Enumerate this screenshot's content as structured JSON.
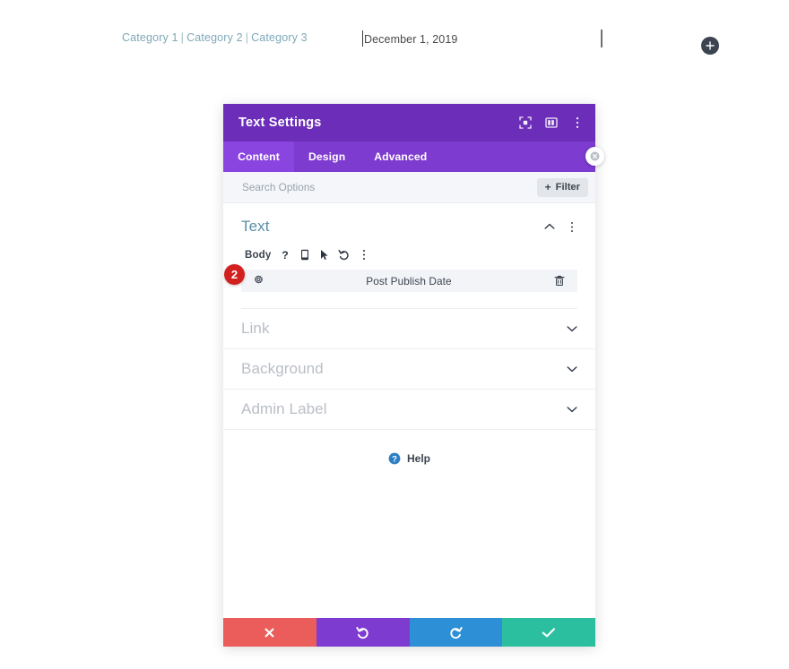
{
  "page": {
    "categories": [
      {
        "label": "Category 1"
      },
      {
        "label": "Category 2"
      },
      {
        "label": "Category 3"
      }
    ],
    "separator": "|",
    "date_text": "December 1, 2019",
    "add_button_icon": "plus-icon",
    "colors": {
      "link": "#7fa8b8",
      "header_purple": "#6c2eb9",
      "tab_purple": "#7e3bd0",
      "tab_active_purple": "#8a45e0",
      "badge_red": "#d2201f",
      "cancel_red": "#eb5d5b",
      "undo_purple": "#7e3bd0",
      "redo_blue": "#2d8fd5",
      "save_green": "#2bbfa0",
      "section_title_blue": "#5b8fa8",
      "muted_gray": "#b9bec5"
    }
  },
  "modal": {
    "title": "Text Settings",
    "header_icons": [
      {
        "name": "focus-target-icon"
      },
      {
        "name": "layout-columns-icon"
      },
      {
        "name": "kebab-menu-icon"
      }
    ],
    "close_icon": "close-icon",
    "tabs": [
      {
        "label": "Content",
        "active": true
      },
      {
        "label": "Design",
        "active": false
      },
      {
        "label": "Advanced",
        "active": false
      }
    ],
    "search": {
      "placeholder": "Search Options",
      "value": ""
    },
    "filter": {
      "label": "Filter",
      "plus": "+"
    },
    "text_section": {
      "title": "Text",
      "collapse_icon": "chevron-up-icon",
      "menu_icon": "kebab-menu-icon",
      "body_label": "Body",
      "body_icons": [
        {
          "name": "question-help-icon"
        },
        {
          "name": "mobile-device-icon"
        },
        {
          "name": "cursor-pointer-icon"
        },
        {
          "name": "reset-undo-icon"
        },
        {
          "name": "kebab-menu-icon"
        }
      ],
      "dynamic_row": {
        "badge": "2",
        "gear_icon": "gear-icon",
        "label": "Post Publish Date",
        "delete_icon": "trash-icon"
      }
    },
    "collapsed_sections": [
      {
        "label": "Link",
        "icon": "chevron-down-icon"
      },
      {
        "label": "Background",
        "icon": "chevron-down-icon"
      },
      {
        "label": "Admin Label",
        "icon": "chevron-down-icon"
      }
    ],
    "help": {
      "label": "Help",
      "icon": "question-circle-icon"
    },
    "footer_buttons": [
      {
        "name": "cancel-button",
        "icon": "x-icon"
      },
      {
        "name": "undo-button",
        "icon": "undo-icon"
      },
      {
        "name": "redo-button",
        "icon": "redo-icon"
      },
      {
        "name": "save-button",
        "icon": "check-icon"
      }
    ]
  }
}
